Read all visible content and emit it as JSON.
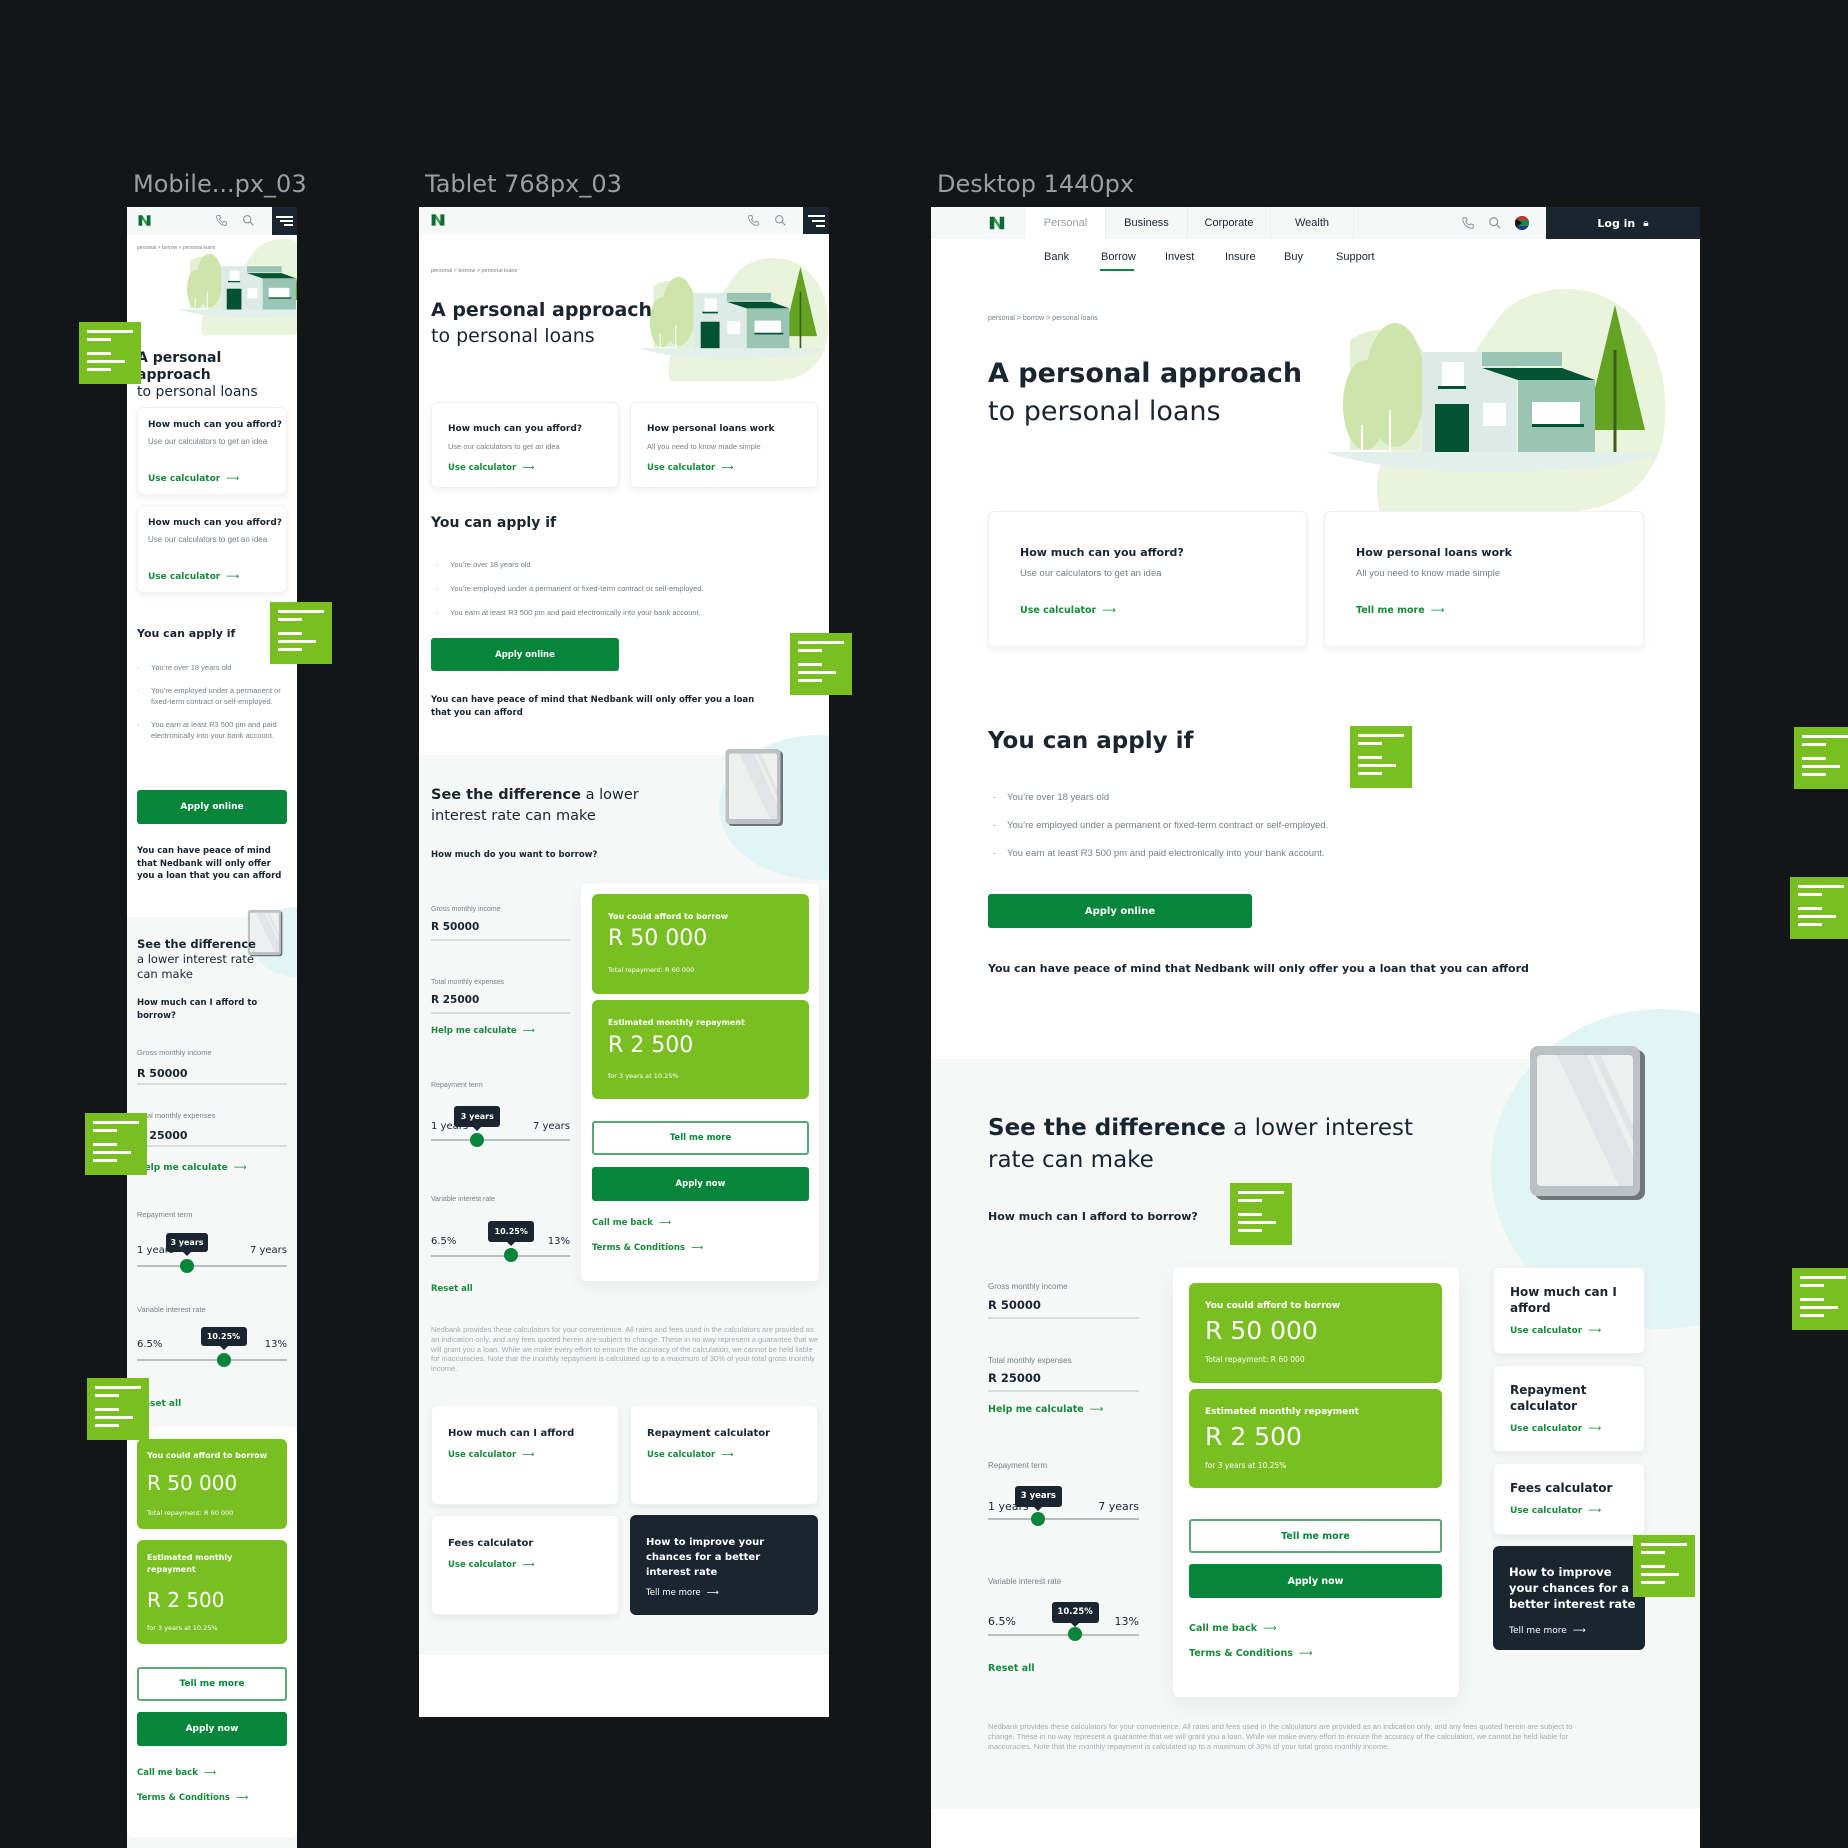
{
  "frames": {
    "mobile_label": "Mobile...px_03",
    "tablet_label": "Tablet 768px_03",
    "desktop_label": "Desktop 1440px"
  },
  "brand": {
    "primary_green": "#07853a",
    "lime_green": "#7abf22",
    "dark_navy": "#1a2530",
    "link_green": "#178a3c"
  },
  "nav": {
    "logo": "nedbank-logo",
    "top_tabs": [
      "Personal",
      "Business",
      "Corporate",
      "Wealth"
    ],
    "active_top_tab": "Personal",
    "sub_nav": [
      "Bank",
      "Borrow",
      "Invest",
      "Insure",
      "Buy",
      "Support"
    ],
    "active_sub_nav": "Borrow",
    "login_label": "Log in",
    "icons": [
      "phone-icon",
      "search-icon",
      "south-africa-flag-icon",
      "lock-icon",
      "menu-icon"
    ]
  },
  "breadcrumb": "personal  >  borrow  >  personal loans",
  "hero": {
    "title_line1": "A personal approach",
    "title_line2": "to personal loans"
  },
  "intro_cards": {
    "desktop": [
      {
        "title": "How much can you afford?",
        "desc": "Use our calculators to get an idea",
        "link": "Use calculator"
      },
      {
        "title": "How personal loans work",
        "desc": "All you need to know made simple",
        "link": "Tell me more"
      }
    ],
    "tablet": [
      {
        "title": "How much can you afford?",
        "desc": "Use our calculators to get an idea",
        "link": "Use calculator"
      },
      {
        "title": "How personal loans work",
        "desc": "All you need to know made simple",
        "link": "Use calculator"
      }
    ],
    "mobile": [
      {
        "title": "How much can you afford?",
        "desc": "Use our calculators to get an idea",
        "link": "Use calculator"
      },
      {
        "title": "How much can you afford?",
        "desc": "Use our calculators to get an idea",
        "link": "Use calculator"
      }
    ]
  },
  "apply": {
    "title": "You can apply if",
    "criteria": [
      "You’re over 18 years old",
      "You’re employed under a permanent or fixed-term contract or self-employed.",
      "You earn at least R3 500 pm and paid electronically into your bank account."
    ],
    "button": "Apply online",
    "peace_of_mind": "You can have peace of mind that Nedbank will only offer you a loan that you can afford"
  },
  "calculator": {
    "title_bold": "See the difference",
    "title_rest": " a lower interest rate can make",
    "question_desktop": "How much can I afford to borrow?",
    "question_tablet": "How much do you want to borrow?",
    "question_mobile": "How much can I afford to borrow?",
    "income_label": "Gross monthly income",
    "income_value": "R 50000",
    "expenses_label": "Total monthly expenses",
    "expenses_value": "R 25000",
    "help_link": "Help me calculate",
    "term_label": "Repayment term",
    "term_min": "1 years",
    "term_max": "7 years",
    "term_value_label": "3 years",
    "term_value": 3,
    "term_range": [
      1,
      7
    ],
    "rate_label": "Variable interest rate",
    "rate_min": "6.5%",
    "rate_max": "13%",
    "rate_value_label": "10.25%",
    "rate_value": 10.25,
    "rate_range": [
      6.5,
      13
    ],
    "reset": "Reset all",
    "result1_label": "You could afford to borrow",
    "result1_value": "R 50 000",
    "result1_sub": "Total repayment: R 60 000",
    "result2_label": "Estimated monthly repayment",
    "result2_value": "R 2 500",
    "result2_sub": "for 3 years at 10.25%",
    "tell_more": "Tell me more",
    "apply_now": "Apply now",
    "call_back": "Call me back",
    "terms": "Terms & Conditions",
    "disclaimer": "Nedbank provides these calculators for your convenience. All rates and fees used in the calculators are provided as an indication only, and any fees quoted herein are subject to change. These in no way represent a guarantee that we will grant you a loan. While we make every effort to ensure the accuracy of the calculation, we cannot be held liable for inaccuracies. Note that the monthly repayment is calculated up to a maximum of 30% of your total gross monthly income."
  },
  "side_cards": [
    {
      "title": "How much can I afford",
      "link": "Use calculator",
      "dark": false
    },
    {
      "title": "Repayment calculator",
      "link": "Use calculator",
      "dark": false
    },
    {
      "title": "Fees calculator",
      "link": "Use calculator",
      "dark": false
    },
    {
      "title": "How to improve your chances for a better interest rate",
      "link": "Tell me more",
      "dark": true
    }
  ]
}
